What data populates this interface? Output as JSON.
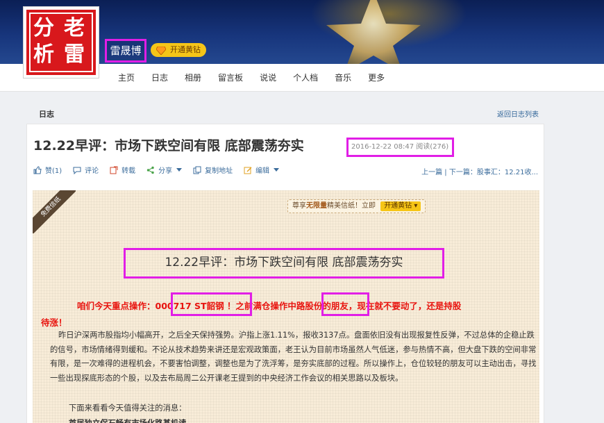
{
  "header": {
    "avatar_chars": [
      "分",
      "析",
      "老",
      "雷"
    ],
    "user_name": "雷晟博",
    "diamond_button": "开通黄钻"
  },
  "nav": {
    "items": [
      "主页",
      "日志",
      "相册",
      "留言板",
      "说说",
      "个人档",
      "音乐",
      "更多"
    ]
  },
  "section": {
    "title": "日志",
    "back_link": "返回日志列表"
  },
  "post": {
    "title": "12.22早评：市场下跌空间有限 底部震荡夯实",
    "meta": "2016-12-22 08:47  阅读(276)",
    "actions": [
      {
        "label": "赞(1)",
        "icon": "thumb-up-icon"
      },
      {
        "label": "评论",
        "icon": "comment-icon"
      },
      {
        "label": "转载",
        "icon": "repost-icon"
      },
      {
        "label": "分享",
        "icon": "share-icon"
      },
      {
        "label": "复制地址",
        "icon": "copy-icon"
      },
      {
        "label": "编辑",
        "icon": "edit-icon"
      }
    ],
    "pager": "上一篇 | 下一篇：股事汇：12.21收..."
  },
  "paper": {
    "ribbon": "免费信纸",
    "promo_prefix": "尊享",
    "promo_bold": "无限量",
    "promo_suffix": "精美信纸！立即",
    "promo_button": "开通黄钻",
    "heading": "12.22早评：市场下跌空间有限 底部震荡夯实",
    "highlight_line1": "咱们今天重点操作：000717 ST韶钢 ！之前满仓操作中路股份的朋友，现在就不要动了，还是持股",
    "highlight_line2": "待涨！",
    "body": "昨日沪深两市股指均小幅高开，之后全天保持强势。沪指上涨1.11%，报收3137点。盘面依旧没有出现报复性反弹，不过总体的企稳止跌的信号，市场情绪得到缓和。不论从技术趋势来讲还是宏观政策面，老王认为目前市场虽然人气低迷，参与热情不高，但大盘下跌的空间非常有限，是一次难得的进程机会，不要害怕调整，调整也是为了洗浮筹，是夯实底部的过程。所以操作上，仓位较轻的朋友可以主动出击，寻找一些出现探底形态的个股，以及去布局周二公开课老王提到的中央经济工作会议的相关思路以及板块。",
    "sub1": "下面来看看今天值得关注的消息：",
    "sub2": "首届独立保石畅有市场化路基机读"
  },
  "colors": {
    "highlight_border": "#e11ee6",
    "red_text": "#e8140f",
    "link": "#3c6d9c",
    "paper_bg": "#f8ecd8",
    "diamond": "#f5c518"
  }
}
